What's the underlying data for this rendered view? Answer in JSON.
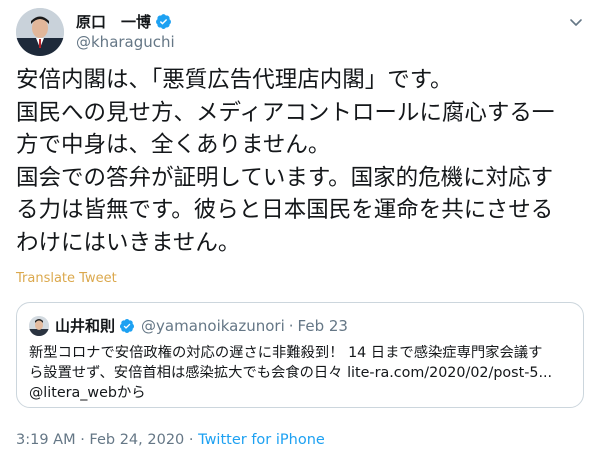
{
  "author": {
    "name": "原口　一博",
    "handle": "@kharaguchi",
    "avatar_icon": "avatar-photo",
    "verified_icon": "verified-badge-icon"
  },
  "tweet": {
    "lines": [
      "安倍内閣は、「悪質広告代理店内閣」です。",
      "国民への見せ方、メディアコントロールに腐心する一",
      "方で中身は、全くありません。",
      "国会での答弁が証明しています。国家的危機に対応す",
      "る力は皆無です。彼らと日本国民を運命を共にさせる",
      "わけにはいきません。"
    ],
    "translate_label": "Translate Tweet"
  },
  "quoted": {
    "name": "山井和則",
    "handle": "@yamanoikazunori",
    "separator": "·",
    "date": "Feb 23",
    "lines": [
      "新型コロナで安倍政権の対応の遅さに非難殺到！ 14 日まで感染症専門家会議す",
      "ら設置せず、安倍首相は感染拡大でも会食の日々 lite-ra.com/2020/02/post-5...",
      "@litera_webから"
    ]
  },
  "footer": {
    "timestamp": "3:19 AM · Feb 24, 2020",
    "separator": " · ",
    "source": "Twitter for iPhone"
  },
  "colors": {
    "verified": "#1da1f2",
    "link": "#1da1f2",
    "translate": "#d59a2e",
    "meta_gray": "#657786",
    "border": "#ccd6dd"
  }
}
